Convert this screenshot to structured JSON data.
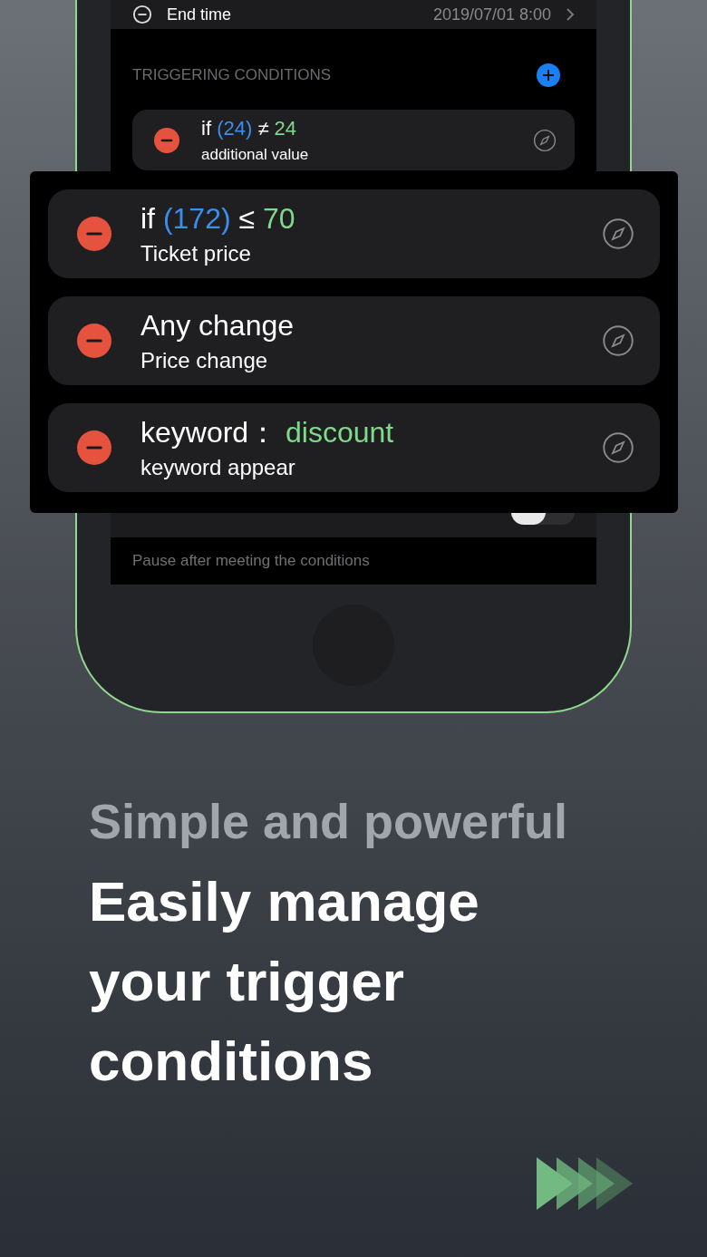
{
  "end_time": {
    "label": "End time",
    "value": "2019/07/01 8:00"
  },
  "triggering": {
    "header": "TRIGGERING CONDITIONS",
    "conditions": [
      {
        "prefix": "if",
        "field": "(24)",
        "operator": "≠",
        "target": "24",
        "caption": "additional value"
      }
    ]
  },
  "popup_conditions": [
    {
      "kind": "compare",
      "prefix": "if",
      "field": "(172)",
      "operator": "≤",
      "target": "70",
      "caption": "Ticket price"
    },
    {
      "kind": "plain",
      "title": "Any change",
      "caption": "Price change"
    },
    {
      "kind": "keyword",
      "prefix": "keyword：",
      "target": "discount",
      "caption": "keyword appear"
    }
  ],
  "auto_pause": {
    "on": false,
    "note": "Pause after meeting the conditions"
  },
  "headline": {
    "subtitle": "Simple and powerful",
    "title": "Easily manage your trigger conditions"
  }
}
